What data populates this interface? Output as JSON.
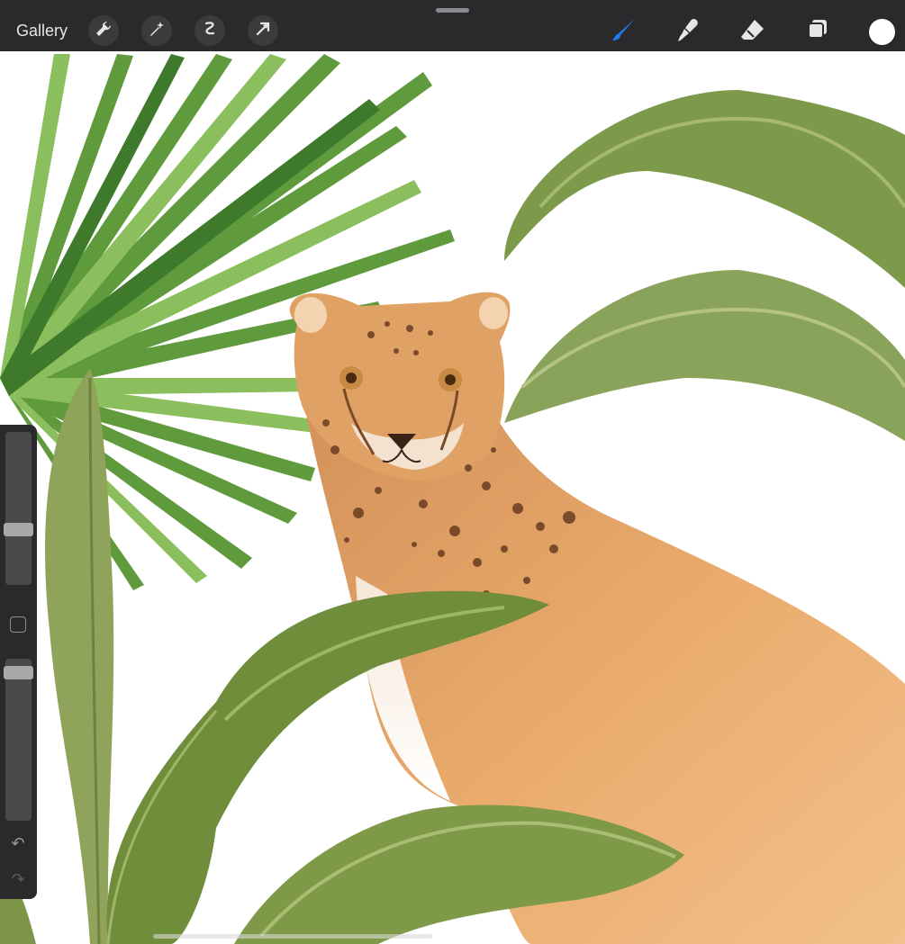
{
  "toolbar": {
    "gallery_label": "Gallery",
    "left_tools": [
      "wrench-icon",
      "magic-wand-icon",
      "selection-icon",
      "transform-arrow-icon"
    ],
    "right_tools": [
      "brush-icon",
      "smudge-icon",
      "eraser-icon",
      "layers-icon"
    ],
    "active_tool": "brush-icon",
    "accent_color": "#1f7cf2",
    "current_color": "#ffffff"
  },
  "sidebar": {
    "brush_size_level": 0.35,
    "opacity_level": 0.95,
    "undo_icon": "undo-icon",
    "redo_icon": "redo-icon"
  }
}
